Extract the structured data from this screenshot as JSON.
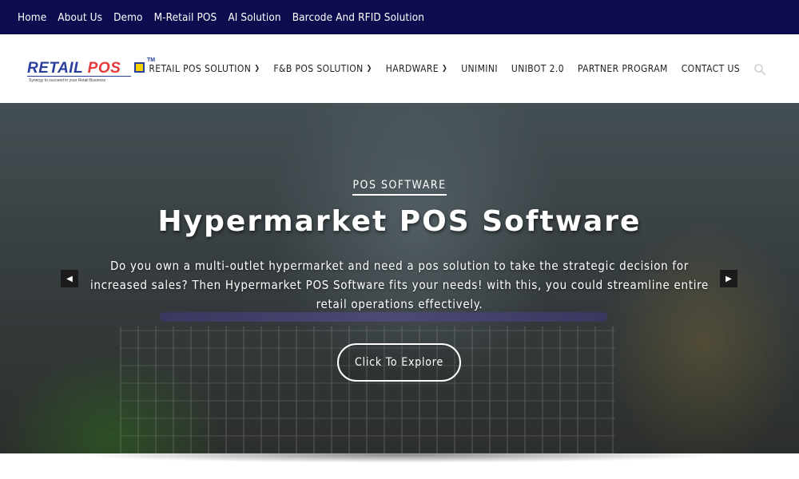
{
  "topbar": {
    "links": [
      "Home",
      "About Us",
      "Demo",
      "M-Retail POS",
      "AI Solution",
      "Barcode And RFID Solution"
    ]
  },
  "logo": {
    "word1": "RETAIL",
    "word2": "POS",
    "tm": "TM",
    "tagline": "Synergy to succeed in your Retail Business"
  },
  "mainnav": {
    "items": [
      {
        "label": "RETAIL POS SOLUTION",
        "has_dropdown": true
      },
      {
        "label": "F&B POS SOLUTION",
        "has_dropdown": true
      },
      {
        "label": "HARDWARE",
        "has_dropdown": true
      },
      {
        "label": "UNIMINI",
        "has_dropdown": false
      },
      {
        "label": "UNIBOT 2.0",
        "has_dropdown": false
      },
      {
        "label": "PARTNER PROGRAM",
        "has_dropdown": false
      },
      {
        "label": "CONTACT US",
        "has_dropdown": false
      }
    ],
    "search_icon": "search-icon"
  },
  "hero": {
    "eyebrow": "POS SOFTWARE",
    "title": "Hypermarket POS Software",
    "description": "Do you own a multi-outlet hypermarket and need a pos solution to take the strategic decision for increased sales? Then Hypermarket POS Software fits your needs! with this, you could streamline entire retail operations effectively.",
    "button": "Click To Explore",
    "prev_icon": "chevron-left-icon",
    "next_icon": "chevron-right-icon"
  },
  "colors": {
    "topbar_bg": "#0c0c4e",
    "logo_blue": "#2a3f9c",
    "logo_red": "#e33a3a",
    "logo_yellow": "#f4d100"
  }
}
